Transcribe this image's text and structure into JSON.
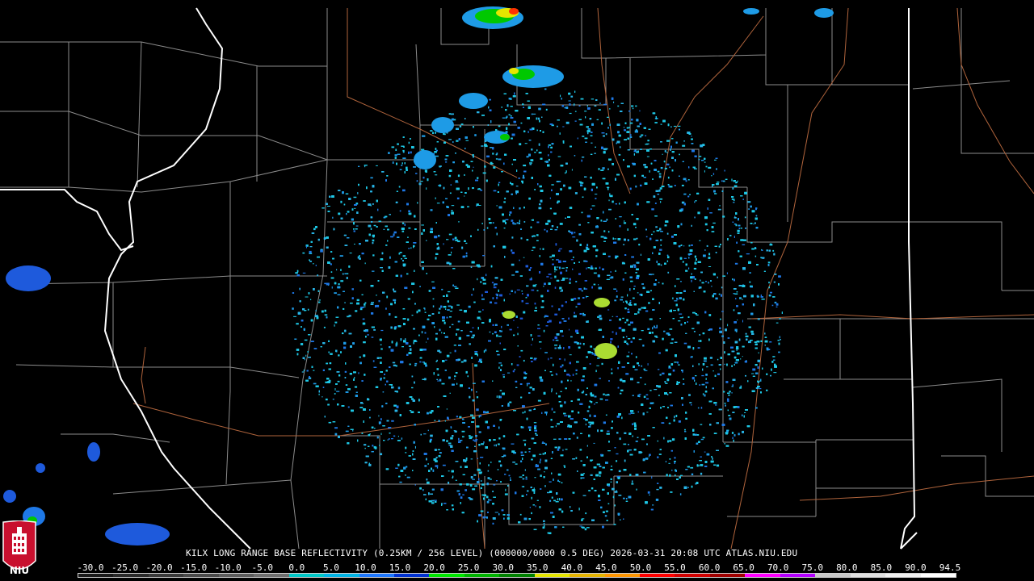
{
  "caption": "KILX LONG RANGE BASE REFLECTIVITY (0.25KM / 256 LEVEL) (000000/0000 0.5 DEG) 2026-03-31 20:08 UTC  ATLAS.NIU.EDU",
  "logo": {
    "text": "NIU",
    "colors": {
      "shield": "#c8102e",
      "tower": "#ffffff",
      "background": "#000000"
    }
  },
  "color_scale": {
    "labels": [
      "-30.0",
      "-25.0",
      "-20.0",
      "-15.0",
      "-10.0",
      "-5.0",
      "0.0",
      "5.0",
      "10.0",
      "15.0",
      "20.0",
      "25.0",
      "30.0",
      "35.0",
      "40.0",
      "45.0",
      "50.0",
      "55.0",
      "60.0",
      "65.0",
      "70.0",
      "75.0",
      "80.0",
      "85.0",
      "90.0",
      "94.5"
    ],
    "segments": [
      "#1a1a1a",
      "#2a2a2a",
      "#3a3a3a",
      "#4a4a4a",
      "#5c5c5c",
      "#6e6e6e",
      "#00c8c8",
      "#00b4e6",
      "#1e78ff",
      "#0032d2",
      "#00e600",
      "#00b400",
      "#008200",
      "#e6e600",
      "#e6b400",
      "#ff9600",
      "#ff0000",
      "#d20000",
      "#a00000",
      "#ff00ff",
      "#b400ff",
      "#c8c8c8",
      "#e0e0e0",
      "#f0f0f0",
      "#ffffff"
    ]
  },
  "map": {
    "colors": {
      "background": "#000000",
      "county_lines": "#8c8c8c",
      "state_lines": "#ffffff",
      "highways": "#b0643c",
      "radar_site": "#000000"
    },
    "radar": {
      "site": "KILX",
      "ring_color_outer": "#1ec8e6",
      "ring_color_inner": "#1e9be6",
      "core_color": "#1e5adc",
      "enhanced_color": "#aadc32"
    }
  }
}
